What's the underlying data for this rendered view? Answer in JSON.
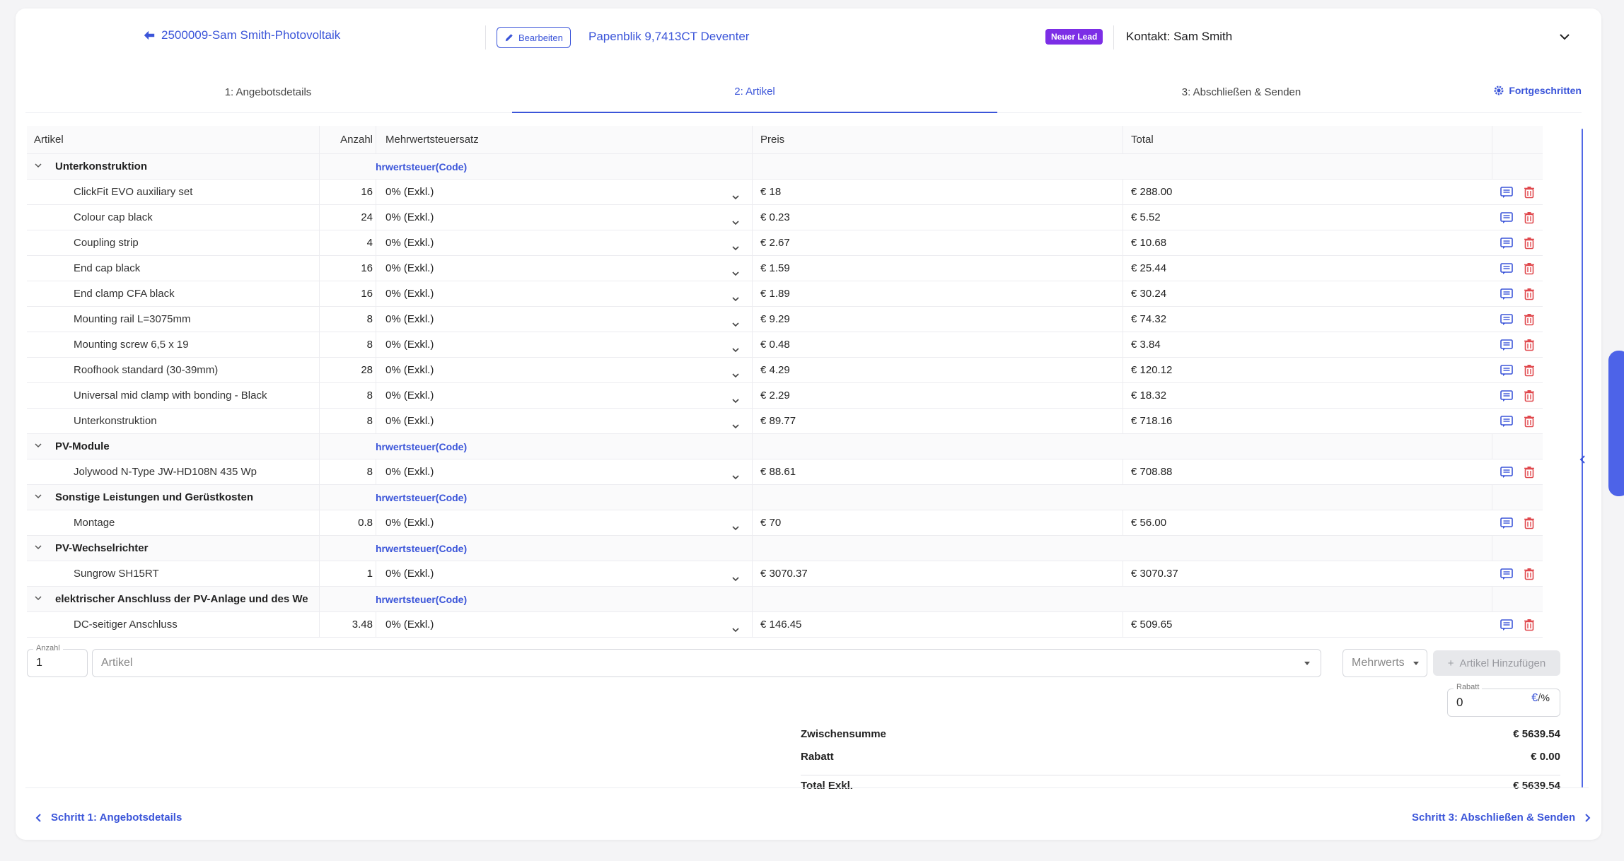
{
  "header": {
    "back_title": "2500009-Sam Smith-Photovoltaik",
    "edit_label": "Bearbeiten",
    "address": "Papenblik 9,7413CT Deventer",
    "lead_badge": "Neuer Lead",
    "contact": "Kontakt: Sam Smith"
  },
  "tabs": [
    {
      "label": "1: Angebotsdetails"
    },
    {
      "label": "2: Artikel"
    },
    {
      "label": "3: Abschließen & Senden"
    }
  ],
  "advanced_label": "Fortgeschritten",
  "table": {
    "columns": [
      "Artikel",
      "Anzahl",
      "Mehrwertsteuersatz",
      "Preis",
      "Total"
    ],
    "groups": [
      {
        "name": "Unterkonstruktion",
        "vat_code": "hrwertsteuer(Code)",
        "items": [
          {
            "name": "ClickFit EVO auxiliary set",
            "qty": "16",
            "vat": "0% (Exkl.)",
            "price": "€ 18",
            "total": "€ 288.00"
          },
          {
            "name": "Colour cap black",
            "qty": "24",
            "vat": "0% (Exkl.)",
            "price": "€ 0.23",
            "total": "€ 5.52"
          },
          {
            "name": "Coupling strip",
            "qty": "4",
            "vat": "0% (Exkl.)",
            "price": "€ 2.67",
            "total": "€ 10.68"
          },
          {
            "name": "End cap black",
            "qty": "16",
            "vat": "0% (Exkl.)",
            "price": "€ 1.59",
            "total": "€ 25.44"
          },
          {
            "name": "End clamp CFA black",
            "qty": "16",
            "vat": "0% (Exkl.)",
            "price": "€ 1.89",
            "total": "€ 30.24"
          },
          {
            "name": "Mounting rail L=3075mm",
            "qty": "8",
            "vat": "0% (Exkl.)",
            "price": "€ 9.29",
            "total": "€ 74.32"
          },
          {
            "name": "Mounting screw 6,5 x 19",
            "qty": "8",
            "vat": "0% (Exkl.)",
            "price": "€ 0.48",
            "total": "€ 3.84"
          },
          {
            "name": "Roofhook standard (30-39mm)",
            "qty": "28",
            "vat": "0% (Exkl.)",
            "price": "€ 4.29",
            "total": "€ 120.12"
          },
          {
            "name": "Universal mid clamp with bonding - Black",
            "qty": "8",
            "vat": "0% (Exkl.)",
            "price": "€ 2.29",
            "total": "€ 18.32"
          },
          {
            "name": "Unterkonstruktion",
            "qty": "8",
            "vat": "0% (Exkl.)",
            "price": "€ 89.77",
            "total": "€ 718.16"
          }
        ]
      },
      {
        "name": "PV-Module",
        "vat_code": "hrwertsteuer(Code)",
        "items": [
          {
            "name": "Jolywood N-Type JW-HD108N 435 Wp",
            "qty": "8",
            "vat": "0% (Exkl.)",
            "price": "€ 88.61",
            "total": "€ 708.88"
          }
        ]
      },
      {
        "name": "Sonstige Leistungen und Gerüstkosten",
        "vat_code": "hrwertsteuer(Code)",
        "items": [
          {
            "name": "Montage",
            "qty": "0.8",
            "vat": "0% (Exkl.)",
            "price": "€ 70",
            "total": "€ 56.00"
          }
        ]
      },
      {
        "name": "PV-Wechselrichter",
        "vat_code": "hrwertsteuer(Code)",
        "items": [
          {
            "name": "Sungrow SH15RT",
            "qty": "1",
            "vat": "0% (Exkl.)",
            "price": "€ 3070.37",
            "total": "€ 3070.37"
          }
        ]
      },
      {
        "name": "elektrischer Anschluss der PV-Anlage und des We",
        "vat_code": "hrwertsteuer(Code)",
        "items": [
          {
            "name": "DC-seitiger Anschluss",
            "qty": "3.48",
            "vat": "0% (Exkl.)",
            "price": "€ 146.45",
            "total": "€ 509.65"
          }
        ]
      }
    ]
  },
  "add_row": {
    "qty_label": "Anzahl",
    "qty_value": "1",
    "article_placeholder": "Artikel",
    "vat_placeholder": "Mehrwerts",
    "add_button": "Artikel Hinzufügen"
  },
  "rabatt": {
    "label": "Rabatt",
    "value": "0",
    "toggle_eur": "€",
    "toggle_pct": "%"
  },
  "summary": {
    "subtotal_label": "Zwischensumme",
    "subtotal_value": "€ 5639.54",
    "discount_label": "Rabatt",
    "discount_value": "€ 0.00",
    "total_label": "Total Exkl.",
    "total_value": "€ 5639.54"
  },
  "footer": {
    "prev": "Schritt 1: Angebotsdetails",
    "next": "Schritt 3: Abschließen & Senden"
  },
  "colors": {
    "accent": "#3b55d9",
    "badge": "#7c2ee6",
    "danger": "#e0484d"
  }
}
